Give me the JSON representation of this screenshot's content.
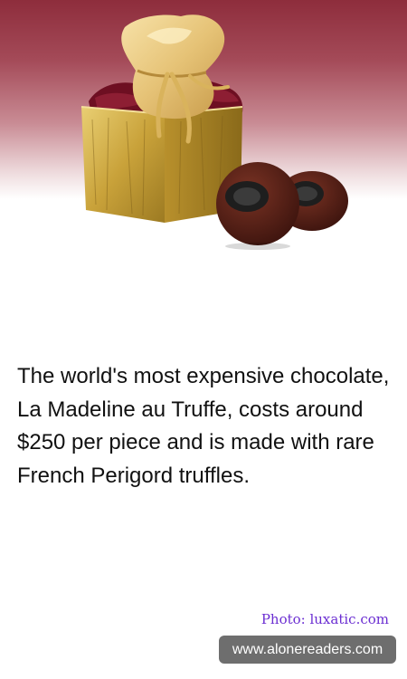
{
  "hero": {
    "image": "chocolate-truffle-gift-box-photo"
  },
  "fact": {
    "text": "The world's most expensive chocolate, La Madeline au Truffe, costs around $250 per piece and is made with rare French Perigord truffles."
  },
  "credit": {
    "text": "Photo: luxatic.com"
  },
  "footer": {
    "site": "www.alonereaders.com"
  },
  "colors": {
    "banner_top": "#8e2d3c",
    "credit": "#6b2ed2",
    "badge": "#6e6e6e"
  }
}
